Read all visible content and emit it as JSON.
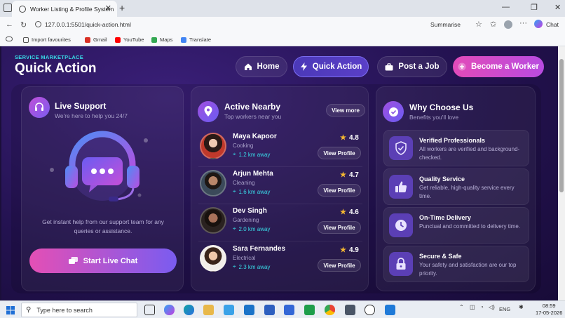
{
  "browser": {
    "tab_title": "Worker Listing & Profile System",
    "close_glyph": "✕",
    "new_tab_glyph": "+",
    "url": "127.0.0.1:5501/quick-action.html",
    "summarise": "Summarise",
    "copilot": "Chat",
    "window_controls": [
      "—",
      "❐",
      "✕"
    ],
    "bookmarks": [
      {
        "label": "Import favourites",
        "icon": "import-icon",
        "color": "#4a4a4a"
      },
      {
        "label": "Gmail",
        "icon": "gmail-icon",
        "color": "#d93025"
      },
      {
        "label": "YouTube",
        "icon": "youtube-icon",
        "color": "#ff0000"
      },
      {
        "label": "Maps",
        "icon": "maps-icon",
        "color": "#34a853"
      },
      {
        "label": "Translate",
        "icon": "translate-icon",
        "color": "#4285f4"
      }
    ]
  },
  "header": {
    "eyebrow": "SERVICE MARKETPLACE",
    "title": "Quick Action",
    "nav": [
      {
        "label": "Home",
        "icon": "home-icon"
      },
      {
        "label": "Quick Action",
        "icon": "lightning-icon",
        "active": true
      },
      {
        "label": "Post a Job",
        "icon": "briefcase-icon"
      },
      {
        "label": "Become a Worker",
        "icon": "plus-circle-icon"
      }
    ]
  },
  "support": {
    "title": "Live Support",
    "subtitle": "We're here to help you 24/7",
    "description": "Get instant help from our support team for any queries or assistance.",
    "button": "Start Live Chat"
  },
  "nearby": {
    "title": "Active Nearby",
    "subtitle": "Top workers near you",
    "view_more": "View more",
    "view_profile": "View Profile",
    "workers": [
      {
        "name": "Maya Kapoor",
        "category": "Cooking",
        "distance": "1.2 km away",
        "rating": "4.8"
      },
      {
        "name": "Arjun Mehta",
        "category": "Cleaning",
        "distance": "1.6 km away",
        "rating": "4.7"
      },
      {
        "name": "Dev Singh",
        "category": "Gardening",
        "distance": "2.0 km away",
        "rating": "4.6"
      },
      {
        "name": "Sara Fernandes",
        "category": "Electrical",
        "distance": "2.3 km away",
        "rating": "4.9"
      }
    ]
  },
  "why": {
    "title": "Why Choose Us",
    "subtitle": "Benefits you'll love",
    "features": [
      {
        "title": "Verified Professionals",
        "desc": "All workers are verified and background-checked.",
        "icon": "shield-check-icon"
      },
      {
        "title": "Quality Service",
        "desc": "Get reliable, high-quality service every time.",
        "icon": "thumbs-up-icon"
      },
      {
        "title": "On-Time Delivery",
        "desc": "Punctual and committed to delivery time.",
        "icon": "clock-icon"
      },
      {
        "title": "Secure & Safe",
        "desc": "Your safety and satisfaction are our top priority.",
        "icon": "lock-icon"
      }
    ]
  },
  "taskbar": {
    "search_placeholder": "Type here to search",
    "lang": "ENG",
    "time": "08:59",
    "date": "17-05-2026"
  },
  "colors": {
    "accent_cyan": "#38d9e6",
    "accent_pink": "#e24bb9",
    "accent_purple": "#7a5cf0",
    "page_bg": "#231250"
  }
}
